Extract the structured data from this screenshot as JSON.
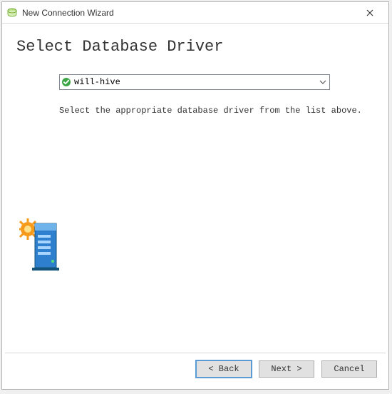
{
  "window": {
    "title": "New Connection Wizard"
  },
  "page": {
    "heading": "Select Database Driver",
    "helper_text": "Select the appropriate database driver from the list above."
  },
  "driver": {
    "selected": "will-hive"
  },
  "buttons": {
    "back": "< Back",
    "next": "Next >",
    "cancel": "Cancel"
  },
  "icons": {
    "app": "app-icon",
    "close": "close-icon",
    "check": "check-circle-icon",
    "chevron": "chevron-down-icon",
    "wizard_art": "database-server-with-sun-icon"
  },
  "colors": {
    "check_green": "#3fa648",
    "focus_blue": "#5a9bd5",
    "server_blue": "#2f7fcf",
    "sun_orange": "#f59a1a"
  }
}
